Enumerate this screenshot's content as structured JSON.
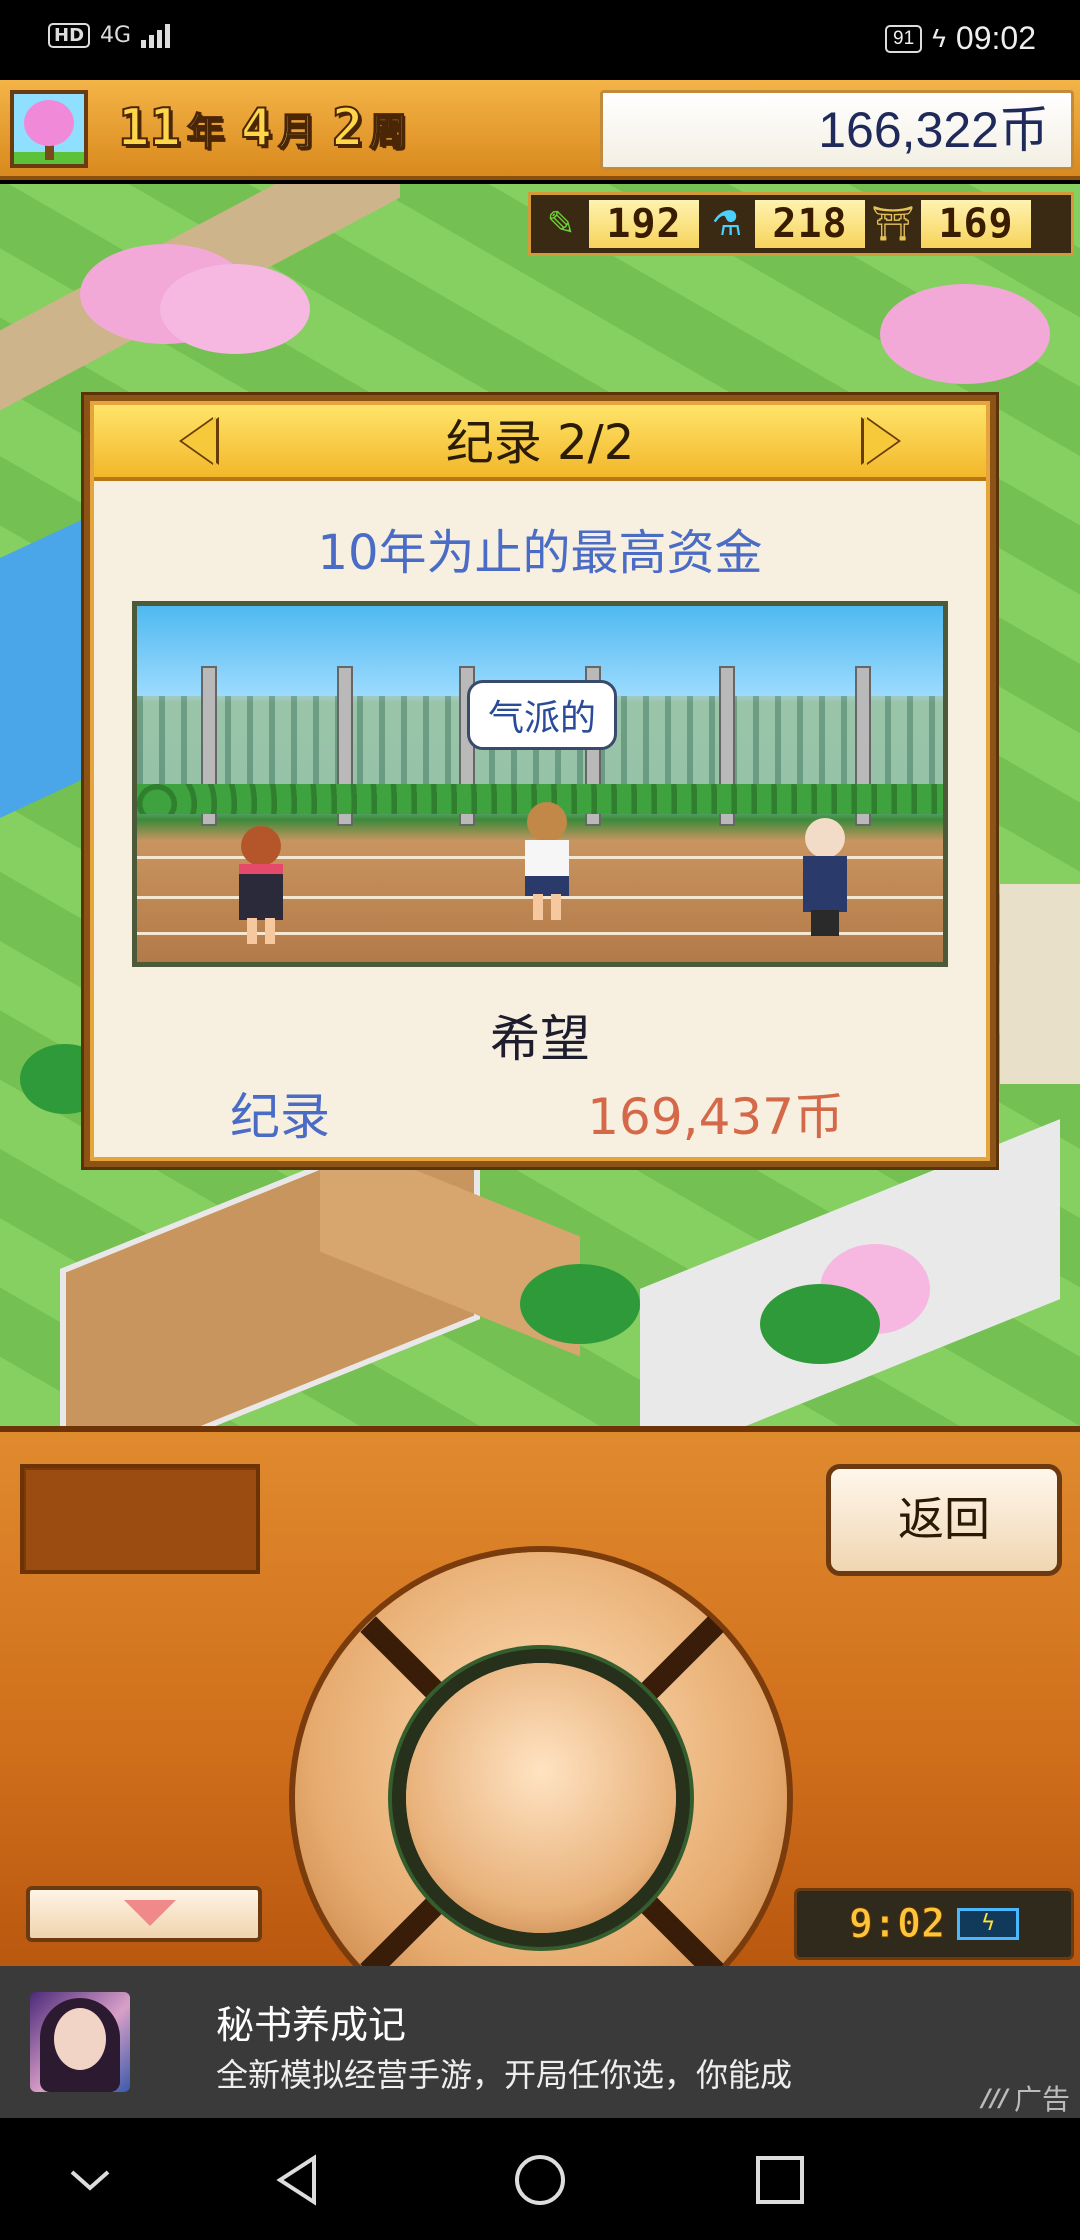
{
  "status_bar": {
    "hd": "HD",
    "network": "4G",
    "battery": "91",
    "time": "09:02"
  },
  "header": {
    "year": "11",
    "year_unit": "年",
    "month": "4",
    "month_unit": "月",
    "week": "2",
    "week_unit": "周",
    "money": "166,322币",
    "tree_icon": "cherry-tree-icon"
  },
  "stats": [
    {
      "icon": "pencil-icon",
      "glyph": "✎",
      "value": "192"
    },
    {
      "icon": "flask-icon",
      "glyph": "⚗",
      "value": "218"
    },
    {
      "icon": "pagoda-icon",
      "glyph": "⛩",
      "value": "169"
    }
  ],
  "dialog": {
    "title": "纪录 2/2",
    "subtitle": "10年为止的最高资金",
    "speech_bubble": "气派的",
    "name": "希望",
    "record_label": "纪录",
    "record_value": "169,437币"
  },
  "controls": {
    "back_label": "返回",
    "clock_time": "9:02"
  },
  "ad": {
    "title": "秘书养成记",
    "description": "全新模拟经营手游，开局任你选，你能成",
    "tag": "广告"
  },
  "colors": {
    "header_bg": "#e9a232",
    "dialog_bg": "#f7efdf",
    "subtitle": "#4a6cc6",
    "record_value": "#d4694a",
    "panel_bg": "#d77a24"
  }
}
